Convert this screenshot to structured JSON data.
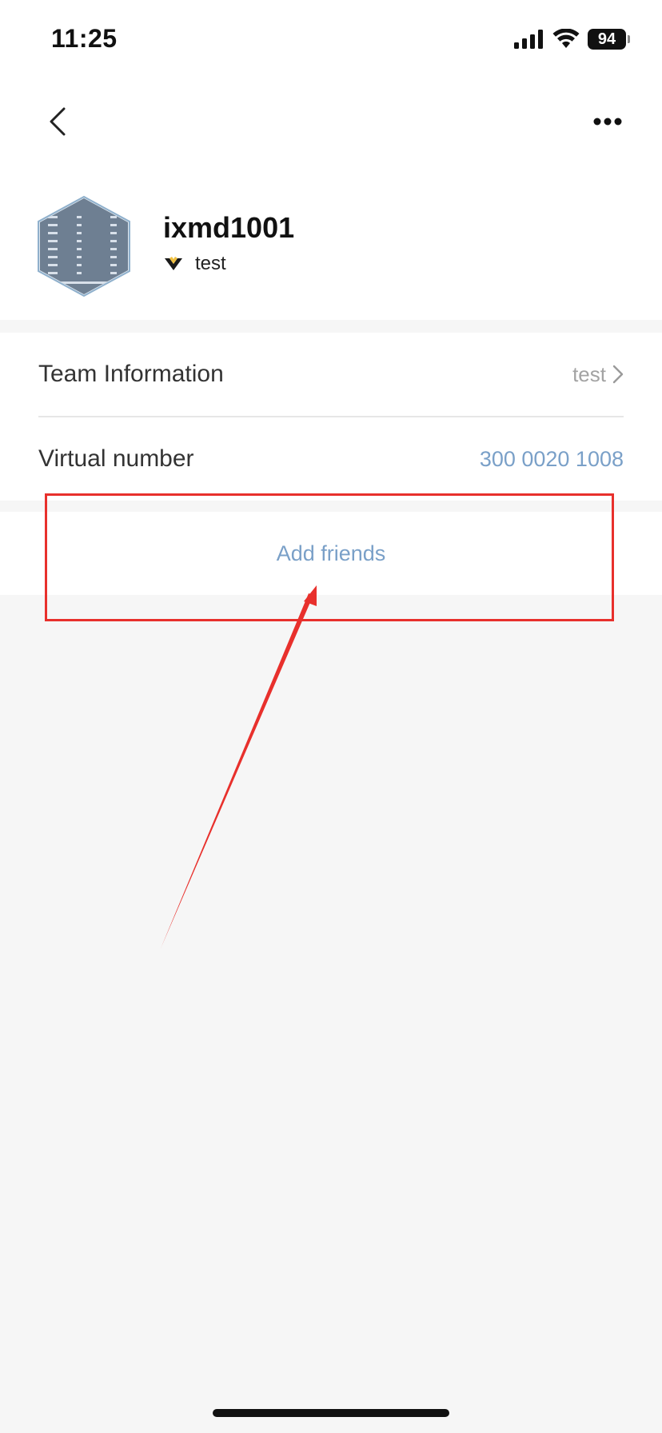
{
  "status_bar": {
    "time": "11:25",
    "battery": "94",
    "icons": [
      "signal-icon",
      "wifi-icon",
      "battery-icon"
    ]
  },
  "nav": {
    "back_icon": "chevron-left-icon",
    "more_icon": "more-horizontal-icon"
  },
  "profile": {
    "name": "ixmd1001",
    "team_label": "test",
    "team_icon": "team-badge-icon"
  },
  "info": {
    "team_information": {
      "label": "Team Information",
      "value": "test"
    },
    "virtual_number": {
      "label": "Virtual number",
      "value": "300 0020 1008"
    }
  },
  "actions": {
    "add_friends": "Add friends"
  },
  "colors": {
    "link_blue": "#7aa0c8",
    "annotation_red": "#e8302c",
    "background": "#f6f6f6",
    "badge_gold": "#f0c040"
  }
}
